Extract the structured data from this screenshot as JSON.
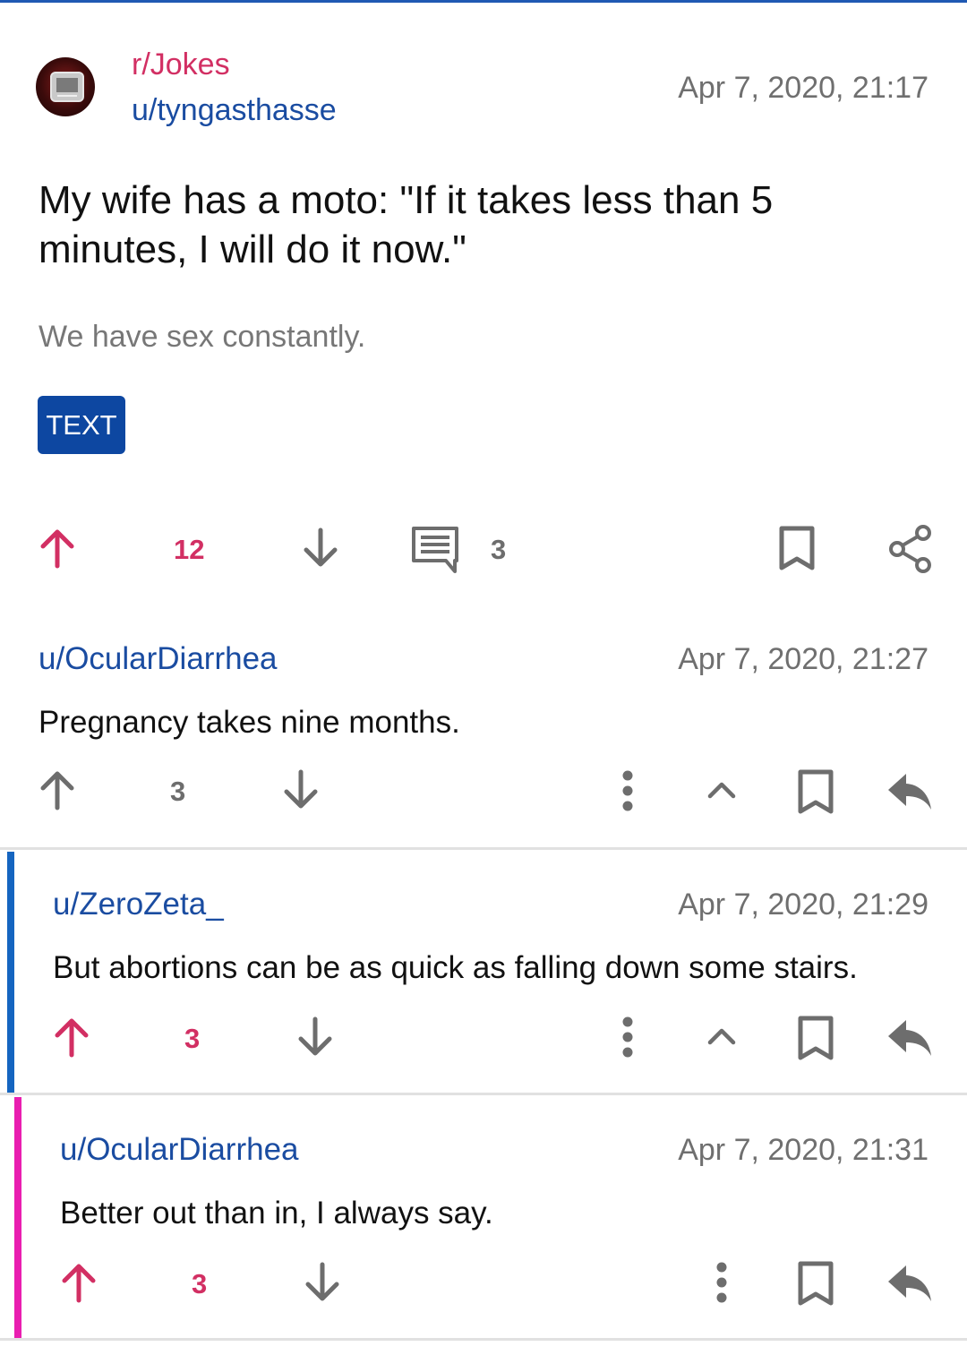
{
  "post": {
    "subreddit": "r/Jokes",
    "author": "u/tyngasthasse",
    "date": "Apr 7, 2020, 21:17",
    "title": "My wife has a moto: \"If it takes less than 5 minutes, I will do it now.\"",
    "body": "We have sex constantly.",
    "flair": "TEXT",
    "score": "12",
    "comment_count": "3",
    "icons": [
      "upvote-icon",
      "downvote-icon",
      "comments-icon",
      "bookmark-icon",
      "share-icon"
    ]
  },
  "comments": [
    {
      "author": "u/OcularDiarrhea",
      "date": "Apr 7, 2020, 21:27",
      "body": "Pregnancy takes nine months.",
      "score": "3",
      "upvoted": false
    },
    {
      "author": "u/ZeroZeta_",
      "date": "Apr 7, 2020, 21:29",
      "body": "But abortions can be as quick as falling down some stairs.",
      "score": "3",
      "upvoted": true,
      "thread_color": "#1565c0"
    },
    {
      "author": "u/OcularDiarrhea",
      "date": "Apr 7, 2020, 21:31",
      "body": "Better out than in, I always say.",
      "score": "3",
      "upvoted": true,
      "thread_color": "#e91eb0"
    }
  ],
  "colors": {
    "accent_pink": "#d22f63",
    "link_blue": "#1a4ca1",
    "flair_bg": "#0d47a1",
    "icon_gray": "#6d6d6d"
  }
}
